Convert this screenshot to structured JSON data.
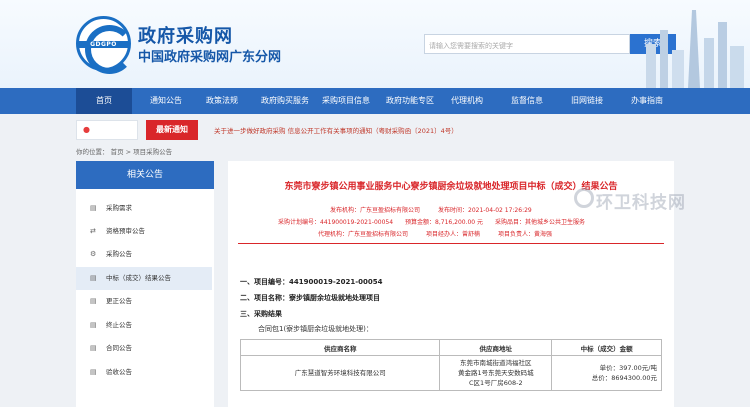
{
  "header": {
    "logo_text": "GDGPO",
    "title": "政府采购网",
    "subtitle": "中国政府采购网广东分网",
    "search_placeholder": "请输入您需要搜索的关键字",
    "search_button": "搜索"
  },
  "nav": {
    "items": [
      "首页",
      "通知公告",
      "政策法规",
      "政府购买服务",
      "采购项目信息",
      "政府功能专区",
      "代理机构",
      "监督信息",
      "旧网链接",
      "办事指南"
    ],
    "active_index": 0
  },
  "notice": {
    "tag": "最新通知",
    "text": "关于进一步做好政府采购 信息公开工作有关事项的通知（粤财采购函〔2021〕4号）"
  },
  "breadcrumb": "你的位置： 首页 > 项目采购公告",
  "sidebar": {
    "heading": "相关公告",
    "items": [
      {
        "icon": "document-icon",
        "glyph": "▤",
        "label": "采购需求"
      },
      {
        "icon": "exchange-icon",
        "glyph": "⇄",
        "label": "资格预审公告"
      },
      {
        "icon": "gear-icon",
        "glyph": "⚙",
        "label": "采购公告"
      },
      {
        "icon": "list-icon",
        "glyph": "▤",
        "label": "中标（成交）结果公告"
      },
      {
        "icon": "list-icon",
        "glyph": "▤",
        "label": "更正公告"
      },
      {
        "icon": "list-icon",
        "glyph": "▤",
        "label": "终止公告"
      },
      {
        "icon": "list-icon",
        "glyph": "▤",
        "label": "合同公告"
      },
      {
        "icon": "list-icon",
        "glyph": "▤",
        "label": "验收公告"
      }
    ],
    "active_index": 3
  },
  "article": {
    "title": "东莞市寮步镇公用事业服务中心寮步镇厨余垃圾就地处理项目中标（成交）结果公告",
    "meta_row1": "发布机构：广东亘盈招标有限公司　　　发布时间：2021-04-02 17:26:29",
    "meta_row2": "采购计划编号：441900019-2021-00054　　预算金额：8,716,200.00 元　　采购品目：其他城乡公共卫生服务",
    "meta_row3": "代理机构：广东亘盈招标有限公司　　　项目经办人：曾舒楠　　　项目负责人：黄海强",
    "sec1": "一、项目编号：441900019-2021-00054",
    "sec2": "二、项目名称：寮步镇厨余垃圾就地处理项目",
    "sec3": "三、采购结果",
    "package": "合同包1(寮步镇厨余垃圾就地处理)：",
    "table": {
      "headers": [
        "供应商名称",
        "供应商地址",
        "中标（成交）金额"
      ],
      "rows": [
        {
          "name": "广东慧道智芳环境科技有限公司",
          "address_lines": [
            "东莞市南城街道鸿福社区",
            "黄金路1号东莞天安数码城",
            "C区1号厂房608-2"
          ],
          "amount_lines": [
            "单价：397.00元/吨",
            "总价：8694300.00元"
          ]
        }
      ]
    }
  },
  "watermark": "环卫科技网"
}
